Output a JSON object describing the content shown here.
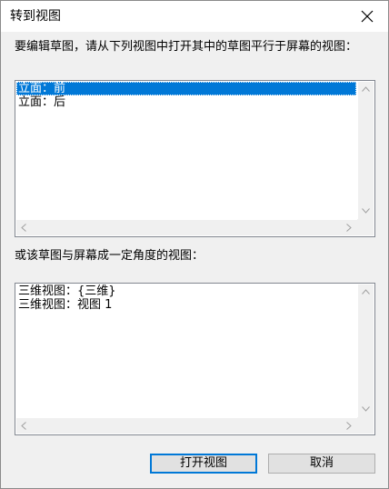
{
  "window": {
    "title": "转到视图"
  },
  "prompt": {
    "text": "要编辑草图，请从下列视图中打开其中的草图平行于屏幕的视图："
  },
  "list_parallel": {
    "items": [
      {
        "label": "立面：前",
        "selected": true
      },
      {
        "label": "立面：后",
        "selected": false
      }
    ]
  },
  "label_angle": {
    "text": "或该草图与屏幕成一定角度的视图："
  },
  "list_angle": {
    "items": [
      {
        "label": "三维视图：{三维}"
      },
      {
        "label": "三维视图：视图 1"
      }
    ]
  },
  "buttons": {
    "open_label": "打开视图",
    "cancel_label": "取消"
  },
  "colors": {
    "selection": "#0078d7",
    "dialog_bg": "#f0f0f0",
    "focus_border": "#0078d7"
  },
  "icons": {
    "close": "close-icon",
    "scroll_up": "chevron-up-icon",
    "scroll_down": "chevron-down-icon",
    "scroll_left": "chevron-left-icon",
    "scroll_right": "chevron-right-icon"
  }
}
